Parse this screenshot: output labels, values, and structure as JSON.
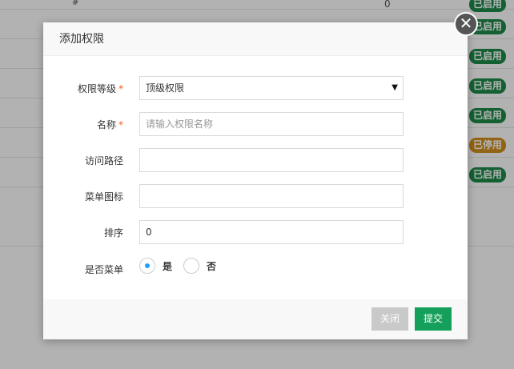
{
  "background": {
    "hash_label": "#",
    "zero_value": "0",
    "rows": [
      {
        "status": "已启用",
        "state": "on"
      },
      {
        "status": "已启用",
        "state": "on"
      },
      {
        "status": "已启用",
        "state": "on"
      },
      {
        "status": "已启用",
        "state": "on"
      },
      {
        "status": "已启用",
        "state": "on"
      },
      {
        "status": "已停用",
        "state": "off"
      },
      {
        "status": "已启用",
        "state": "on"
      }
    ]
  },
  "modal": {
    "title": "添加权限",
    "close_icon": "✕",
    "fields": {
      "level": {
        "label": "权限等级",
        "required_mark": "*",
        "value": "顶级权限",
        "arrow": "▼"
      },
      "name": {
        "label": "名称",
        "required_mark": "*",
        "placeholder": "请输入权限名称",
        "value": ""
      },
      "path": {
        "label": "访问路径",
        "value": ""
      },
      "icon": {
        "label": "菜单图标",
        "value": ""
      },
      "order": {
        "label": "排序",
        "value": "0"
      },
      "is_menu": {
        "label": "是否菜单",
        "options": [
          {
            "label": "是",
            "checked": true
          },
          {
            "label": "否",
            "checked": false
          }
        ]
      }
    },
    "buttons": {
      "close_label": "关闭",
      "submit_label": "提交"
    }
  }
}
